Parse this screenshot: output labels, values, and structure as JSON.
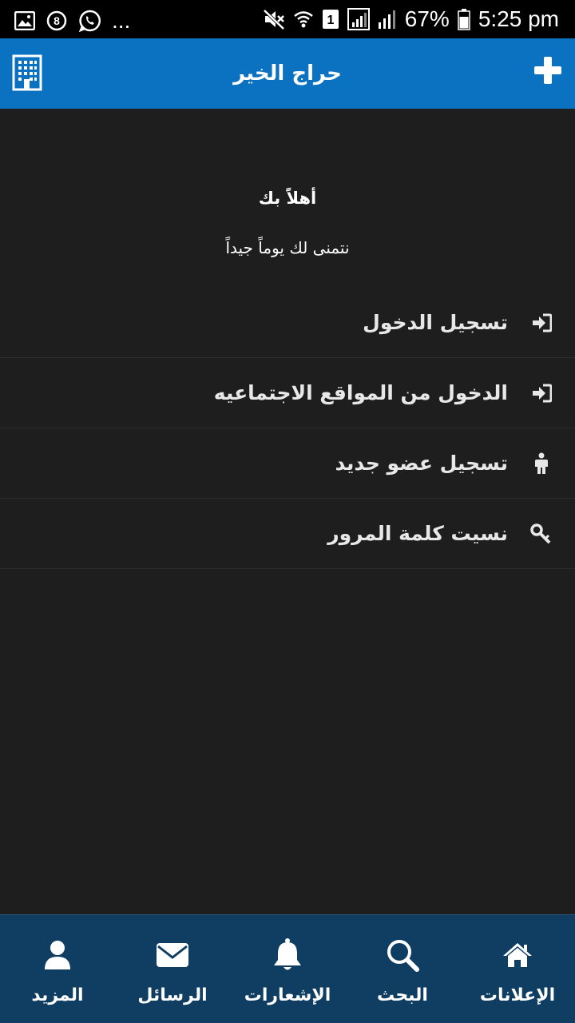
{
  "status_bar": {
    "battery": "67%",
    "time": "5:25 pm",
    "overflow": "...",
    "sim_label": "1",
    "app_badge": "8",
    "left_icons": [
      "image-icon",
      "app-8-icon",
      "whatsapp-icon"
    ],
    "right_icons": [
      "mute-icon",
      "wifi-icon",
      "sim-1-icon",
      "signal-icon",
      "signal-icon",
      "battery-icon"
    ]
  },
  "header": {
    "title": "حراج الخير",
    "left_icon": "building-icon",
    "right_icon": "plus-icon"
  },
  "welcome": {
    "title": "أهلاً بك",
    "subtitle": "نتمنى لك يوماً جيداً"
  },
  "menu": {
    "items": [
      {
        "label": "تسجيل الدخول",
        "icon": "sign-in-icon"
      },
      {
        "label": "الدخول من المواقع الاجتماعيه",
        "icon": "sign-in-icon"
      },
      {
        "label": "تسجيل عضو جديد",
        "icon": "person-icon"
      },
      {
        "label": "نسيت كلمة المرور",
        "icon": "key-icon"
      }
    ]
  },
  "bottom_nav": {
    "items": [
      {
        "label": "الإعلانات",
        "icon": "home-icon"
      },
      {
        "label": "البحث",
        "icon": "search-icon"
      },
      {
        "label": "الإشعارات",
        "icon": "bell-icon"
      },
      {
        "label": "الرسائل",
        "icon": "envelope-icon"
      },
      {
        "label": "المزيد",
        "icon": "user-icon"
      }
    ]
  },
  "colors": {
    "header_bg": "#0a72c1",
    "body_bg": "#1e1e1f",
    "bottom_nav_bg": "#103e63"
  }
}
